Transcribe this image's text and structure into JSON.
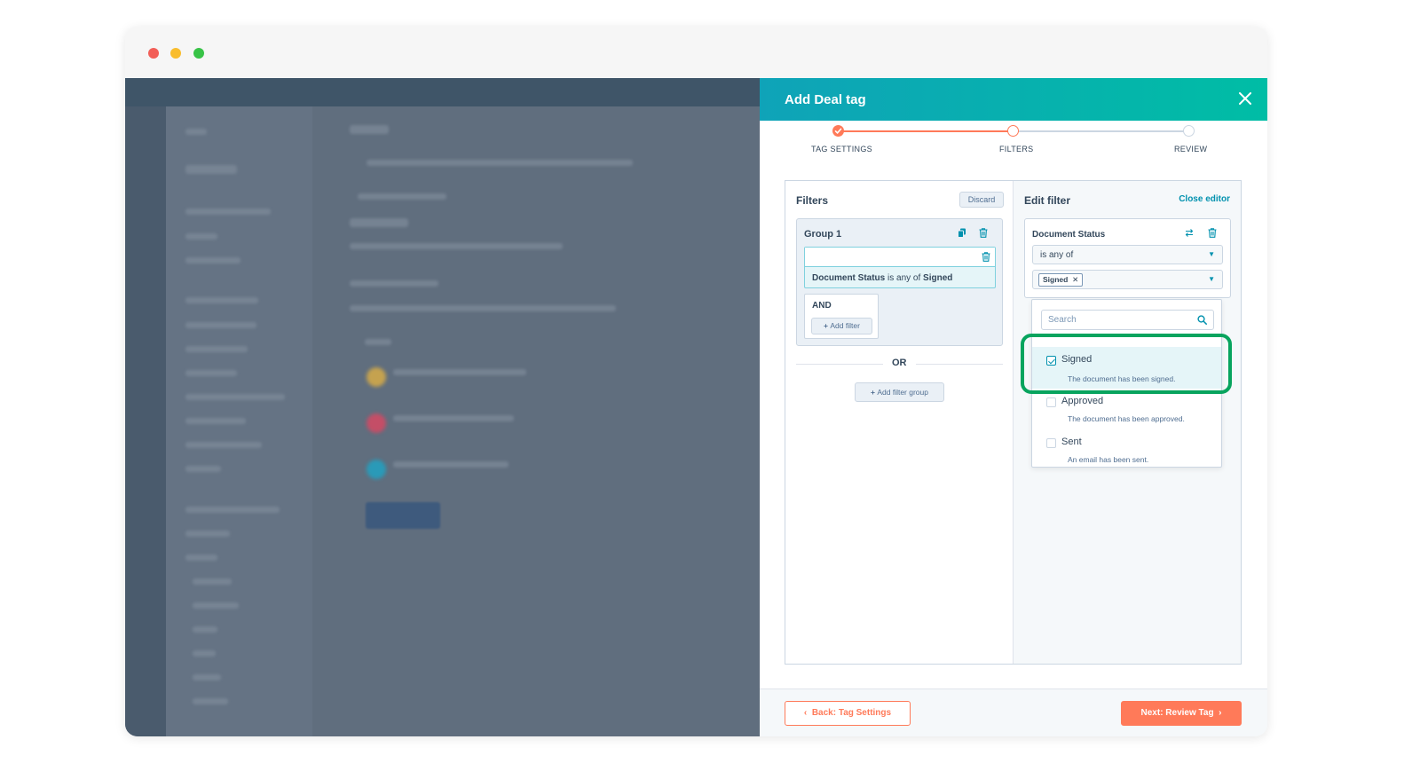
{
  "panel": {
    "title": "Add Deal tag"
  },
  "stepper": {
    "steps": [
      {
        "label": "TAG SETTINGS",
        "state": "complete"
      },
      {
        "label": "FILTERS",
        "state": "current"
      },
      {
        "label": "REVIEW",
        "state": "pending"
      }
    ]
  },
  "filters": {
    "title": "Filters",
    "discard_label": "Discard",
    "group_title": "Group 1",
    "filter_summary": {
      "property": "Document Status",
      "operator": "is any of",
      "value": "Signed"
    },
    "and_label": "AND",
    "add_filter_label": "Add filter",
    "or_label": "OR",
    "add_filter_group_label": "Add filter group"
  },
  "edit_filter": {
    "title": "Edit filter",
    "close_editor_label": "Close editor",
    "property_name": "Document Status",
    "operator_value": "is any of",
    "selected_tag": "Signed",
    "search_placeholder": "Search",
    "options": [
      {
        "label": "Signed",
        "description": "The document has been signed.",
        "checked": true
      },
      {
        "label": "Approved",
        "description": "The document has been approved.",
        "checked": false
      },
      {
        "label": "Sent",
        "description": "An email has been sent.",
        "checked": false
      }
    ]
  },
  "footer": {
    "back_label": "Back: Tag Settings",
    "next_label": "Next: Review Tag"
  },
  "colors": {
    "header_gradient_start": "#0fa3b8",
    "header_gradient_end": "#00bda5",
    "accent_orange": "#ff7a59",
    "accent_teal": "#0091ae",
    "highlight_green": "#08a45e"
  }
}
